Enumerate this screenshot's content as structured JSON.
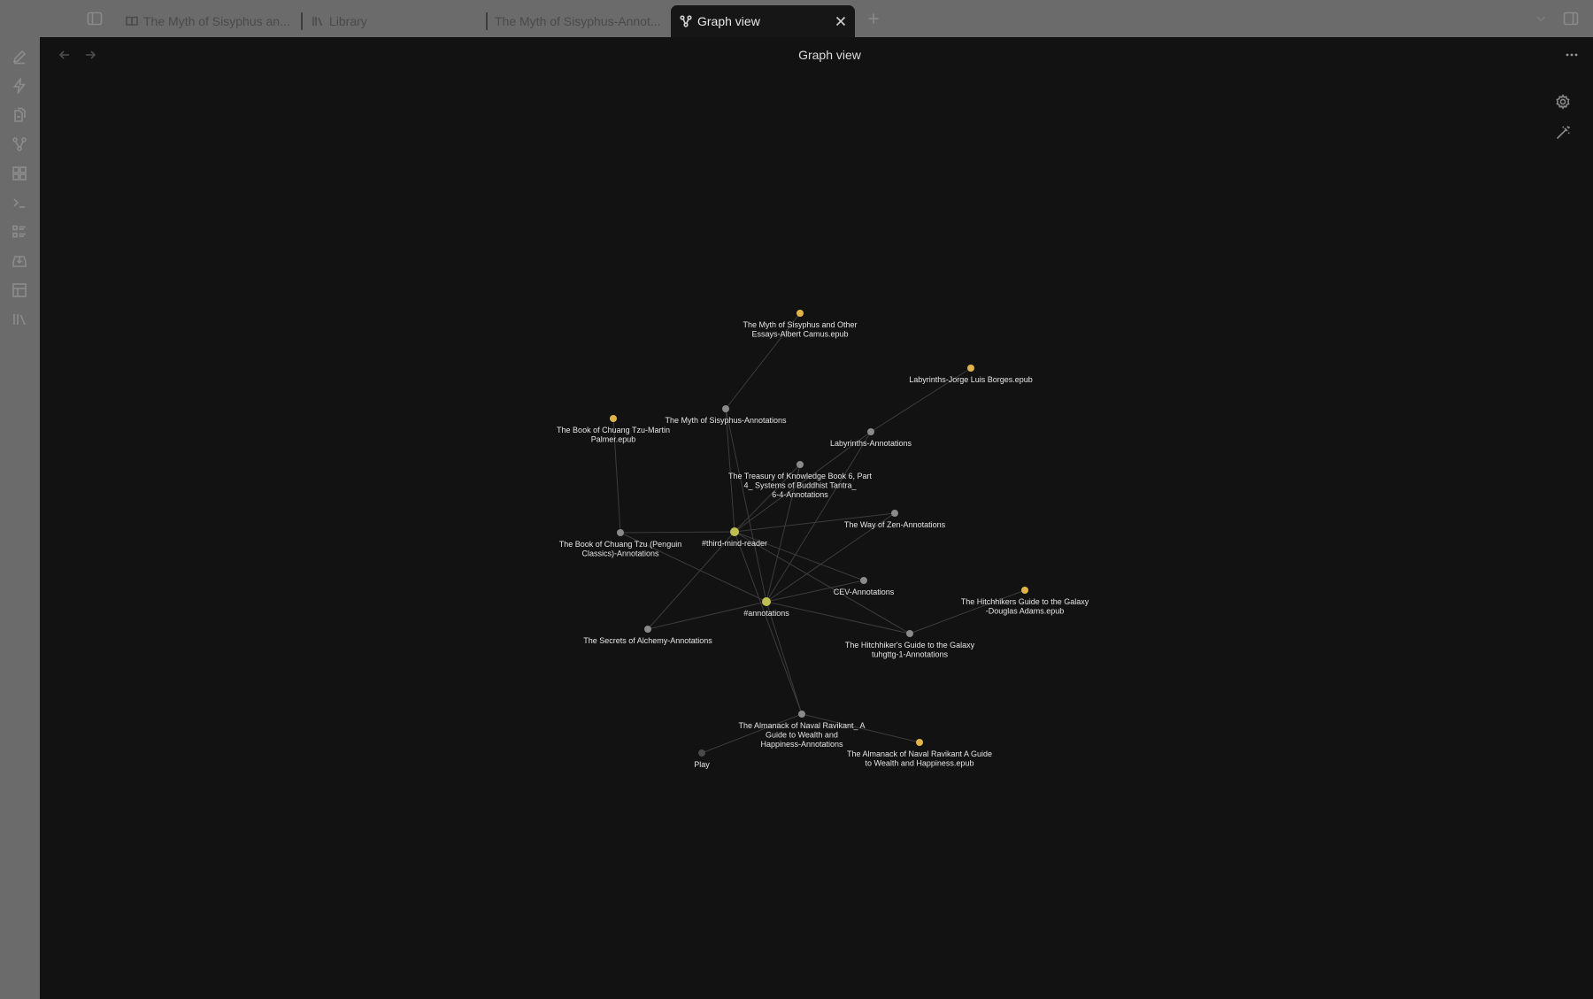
{
  "tabs": [
    {
      "label": "The Myth of Sisyphus an...",
      "icon": "book-open-icon"
    },
    {
      "label": "Library",
      "icon": "library-icon"
    },
    {
      "label": "The Myth of Sisyphus-Annot...",
      "icon": ""
    },
    {
      "label": "Graph view",
      "icon": "graph-icon",
      "active": true
    }
  ],
  "view": {
    "title": "Graph view"
  },
  "ribbon": {
    "icons": [
      "pencil-icon",
      "lightning-icon",
      "file-transfer-icon",
      "graph-icon",
      "dashboard-icon",
      "terminal-icon",
      "checklist-icon",
      "download-box-icon",
      "table-layout-icon",
      "library-icon"
    ]
  },
  "colors": {
    "attachment_node": "#e0b44a",
    "tag_node": "#bfbf50",
    "note_node": "#8a8a8a",
    "unresolved_node": "#4a4a4a",
    "edge": "#3c3c3c",
    "background": "#121212",
    "chrome": "#6b6b6b"
  },
  "graph": {
    "nodes": [
      {
        "id": "myth-epub",
        "label": [
          "The Myth of Sisyphus and Other",
          "Essays-Albert Camus.epub"
        ],
        "kind": "attachment"
      },
      {
        "id": "labyrinths-epub",
        "label": [
          "Labyrinths-Jorge Luis Borges.epub"
        ],
        "kind": "attachment"
      },
      {
        "id": "myth-ann",
        "label": [
          "The Myth of Sisyphus-Annotations"
        ],
        "kind": "note"
      },
      {
        "id": "chuang-epub",
        "label": [
          "The Book of Chuang Tzu-Martin",
          "Palmer.epub"
        ],
        "kind": "attachment"
      },
      {
        "id": "labyrinths-ann",
        "label": [
          "Labyrinths-Annotations"
        ],
        "kind": "note"
      },
      {
        "id": "treasury-ann",
        "label": [
          "The Treasury of Knowledge Book 6, Part",
          "4_ Systems of Buddhist Tantra_",
          "6-4-Annotations"
        ],
        "kind": "note"
      },
      {
        "id": "zen-ann",
        "label": [
          "The Way of Zen-Annotations"
        ],
        "kind": "note"
      },
      {
        "id": "chuang-ann",
        "label": [
          "The Book of Chuang Tzu (Penguin",
          "Classics)-Annotations"
        ],
        "kind": "note"
      },
      {
        "id": "tmr",
        "label": [
          "#third-mind-reader"
        ],
        "kind": "tag"
      },
      {
        "id": "cev-ann",
        "label": [
          "CEV-Annotations"
        ],
        "kind": "note"
      },
      {
        "id": "hitch-epub",
        "label": [
          "The Hitchhikers Guide to the Galaxy",
          "-Douglas Adams.epub"
        ],
        "kind": "attachment"
      },
      {
        "id": "annotations",
        "label": [
          "#annotations"
        ],
        "kind": "tag"
      },
      {
        "id": "alchemy-ann",
        "label": [
          "The Secrets of Alchemy-Annotations"
        ],
        "kind": "note"
      },
      {
        "id": "hitch-ann",
        "label": [
          "The Hitchhiker's Guide to the Galaxy",
          "tuhgttg-1-Annotations"
        ],
        "kind": "note"
      },
      {
        "id": "naval-ann",
        "label": [
          "The Almanack of Naval Ravikant_ A",
          "Guide to Wealth and",
          "Happiness-Annotations"
        ],
        "kind": "note"
      },
      {
        "id": "naval-epub",
        "label": [
          "The Almanack of Naval Ravikant A Guide",
          "to Wealth and Happiness.epub"
        ],
        "kind": "attachment"
      },
      {
        "id": "play",
        "label": [
          "Play"
        ],
        "kind": "unresolved"
      }
    ],
    "edges": [
      [
        "myth-epub",
        "myth-ann"
      ],
      [
        "labyrinths-epub",
        "labyrinths-ann"
      ],
      [
        "chuang-epub",
        "chuang-ann"
      ],
      [
        "hitch-epub",
        "hitch-ann"
      ],
      [
        "naval-epub",
        "naval-ann"
      ],
      [
        "myth-ann",
        "tmr"
      ],
      [
        "myth-ann",
        "annotations"
      ],
      [
        "labyrinths-ann",
        "tmr"
      ],
      [
        "labyrinths-ann",
        "annotations"
      ],
      [
        "treasury-ann",
        "tmr"
      ],
      [
        "treasury-ann",
        "annotations"
      ],
      [
        "zen-ann",
        "tmr"
      ],
      [
        "zen-ann",
        "annotations"
      ],
      [
        "chuang-ann",
        "tmr"
      ],
      [
        "chuang-ann",
        "annotations"
      ],
      [
        "cev-ann",
        "tmr"
      ],
      [
        "cev-ann",
        "annotations"
      ],
      [
        "hitch-ann",
        "tmr"
      ],
      [
        "hitch-ann",
        "annotations"
      ],
      [
        "alchemy-ann",
        "tmr"
      ],
      [
        "alchemy-ann",
        "annotations"
      ],
      [
        "naval-ann",
        "tmr"
      ],
      [
        "naval-ann",
        "annotations"
      ],
      [
        "play",
        "naval-ann"
      ]
    ]
  }
}
